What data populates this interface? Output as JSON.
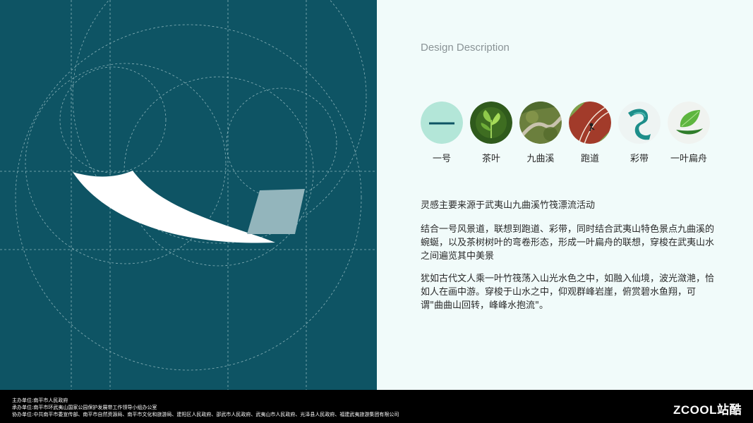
{
  "design": {
    "title": "Design Description"
  },
  "icons": [
    {
      "label": "一号",
      "icon": "dash-icon",
      "color": "#b3e6d8"
    },
    {
      "label": "茶叶",
      "icon": "tea-leaf-icon",
      "color": "#2f5a1c"
    },
    {
      "label": "九曲溪",
      "icon": "river-valley-icon",
      "color": "#6b7f3d"
    },
    {
      "label": "跑道",
      "icon": "running-track-icon",
      "color": "#a23b2a"
    },
    {
      "label": "彩带",
      "icon": "ribbon-icon",
      "color": "#1d8e8a"
    },
    {
      "label": "一叶扁舟",
      "icon": "leaf-boat-icon",
      "color": "#3d9a34"
    }
  ],
  "description": {
    "p1": "灵感主要来源于武夷山九曲溪竹筏漂流活动",
    "p2": "结合一号风景道，联想到跑道、彩带，同时结合武夷山特色景点九曲溪的蜿蜒，以及茶树树叶的弯卷形态，形成一叶扁舟的联想，穿梭在武夷山水之间遍览其中美景",
    "p3": "犹如古代文人乘一叶竹筏荡入山光水色之中，如融入仙境，波光潋滟，恰如人在画中游。穿梭于山水之中，仰观群峰岩崖，俯赏碧水鱼翔，可谓\"曲曲山回转，峰峰水抱流\"。"
  },
  "footer": {
    "host": "主办单位:南平市人民政府",
    "organizer": "承办单位:南平市环武夷山国家公园保护发展带工作领导小组办公室",
    "co_organizer": "协办单位:中共南平市委宣传部、南平市自然资源局、南平市文化和旅游局、建阳区人民政府、邵武市人民政府、武夷山市人民政府、光泽县人民政府、福建武夷旅游集团有限公司",
    "brand": "ZCOOL站酷"
  },
  "colors": {
    "panel_teal": "#0e5464",
    "right_bg": "#f1fbfa",
    "footer_bg": "#000000"
  }
}
